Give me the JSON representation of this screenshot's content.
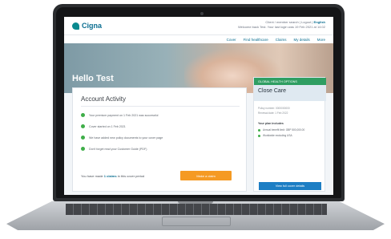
{
  "header": {
    "brand": "Cigna",
    "utility_line1": "Client / member search  |  Logout  |",
    "language": "English",
    "utility_line2": "Welcome back Test. Your last login was 19 Feb 2021 at 14:02"
  },
  "nav": {
    "items": [
      "Cover",
      "Find healthcare",
      "Claims",
      "My details",
      "More"
    ]
  },
  "hero": {
    "greeting": "Hello Test"
  },
  "activity": {
    "title": "Account Activity",
    "items": [
      "Your premium payment on 1 Feb 2021 was successful",
      "Cover started on 1 Feb 2021",
      "We have added new policy documents to your cover page",
      "Don't forget read your Customer Guide (PDF)"
    ],
    "claims_prefix": "You have made",
    "claims_count": "1 claims",
    "claims_suffix": "in this cover period",
    "claim_button": "Make a claim"
  },
  "plan": {
    "tag": "GLOBAL HEALTH OPTIONS",
    "name": "Close Care",
    "policy_number": "Policy number: 0000000000",
    "renewal_date": "Renewal date: 1 Feb 2022",
    "includes_title": "Your plan includes",
    "includes": [
      "Annual benefit limit: GBP 500,000.00",
      "Worldwide excluding USA"
    ],
    "button": "View full cover details"
  }
}
